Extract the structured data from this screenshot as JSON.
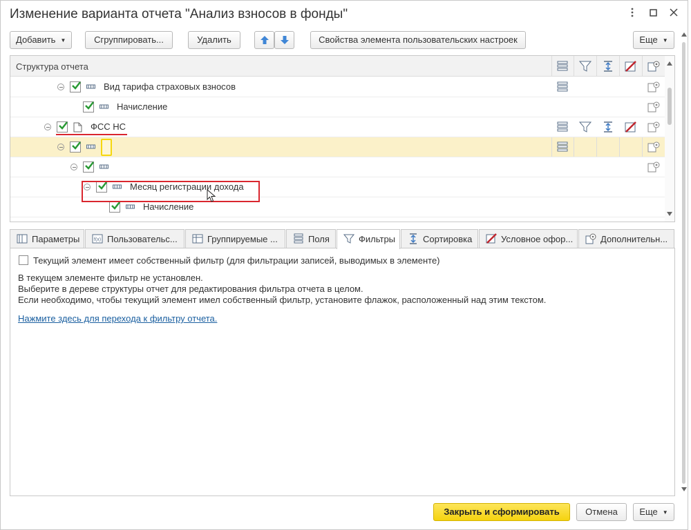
{
  "window": {
    "title": "Изменение варианта отчета \"Анализ взносов в фонды\"",
    "controls": [
      "more-vertical-icon",
      "maximize-icon",
      "close-icon"
    ]
  },
  "toolbar": {
    "add": "Добавить",
    "group": "Сгруппировать...",
    "delete": "Удалить",
    "properties": "Свойства элемента пользовательских настроек",
    "more": "Еще"
  },
  "tree": {
    "header": "Структура отчета",
    "column_icons": [
      "fields-icon",
      "filter-icon",
      "sort-icon",
      "conditional-format-icon",
      "settings-icon"
    ],
    "rows": [
      {
        "label": "Вид тарифа страховых взносов",
        "checked": true
      },
      {
        "label": "Начисление",
        "checked": true
      },
      {
        "label": "ФСС НС",
        "checked": true
      },
      {
        "label": "",
        "checked": true
      },
      {
        "label": "",
        "checked": true
      },
      {
        "label": "Месяц регистрации дохода",
        "checked": true
      },
      {
        "label": "Начисление",
        "checked": true
      }
    ]
  },
  "tabs": [
    {
      "label": "Параметры",
      "icon": "parameters-icon"
    },
    {
      "label": "Пользовательс...",
      "icon": "custom-fields-icon"
    },
    {
      "label": "Группируемые ...",
      "icon": "grouping-icon"
    },
    {
      "label": "Поля",
      "icon": "fields-icon"
    },
    {
      "label": "Фильтры",
      "icon": "filter-icon",
      "active": true
    },
    {
      "label": "Сортировка",
      "icon": "sort-icon"
    },
    {
      "label": "Условное офор...",
      "icon": "conditional-format-icon"
    },
    {
      "label": "Дополнительн...",
      "icon": "settings-icon"
    }
  ],
  "filter_panel": {
    "own_filter_checkbox": "Текущий элемент имеет собственный фильтр (для фильтрации записей, выводимых в элементе)",
    "own_filter_checked": false,
    "line1": "В текущем элементе фильтр не установлен.",
    "line2": "Выберите в дереве структуры отчет для редактирования фильтра отчета в целом.",
    "line3": "Если необходимо, чтобы текущий элемент имел собственный фильтр, установите флажок, расположенный над этим текстом.",
    "link": "Нажмите здесь для перехода к фильтру отчета."
  },
  "footer": {
    "primary": "Закрыть и сформировать",
    "cancel": "Отмена",
    "more": "Еще"
  },
  "colors": {
    "accent_yellow": "#f5d70f",
    "selection": "#fbf1c9",
    "highlight_red": "#d9262e",
    "check_green": "#2a9a35",
    "link": "#1a5fa0"
  }
}
